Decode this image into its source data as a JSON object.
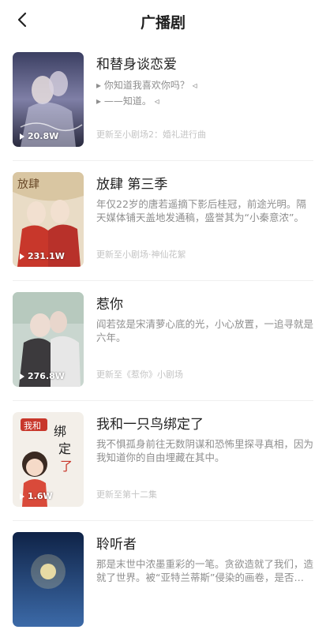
{
  "header": {
    "title": "广播剧"
  },
  "items": [
    {
      "name": "和替身谈恋爱",
      "lyrics": [
        "▸ 你知道我喜欢你吗？ ◃",
        "▸ ——知道。 ◃"
      ],
      "plays": "20.8W",
      "updated": "更新至小剧场2：婚礼进行曲",
      "cover_color": "#4a4f70"
    },
    {
      "name": "放肆 第三季",
      "desc": "年仅22岁的唐若遥摘下影后桂冠，前途光明。隔天媒体铺天盖地发通稿，盛誉其为“小秦意浓”。",
      "plays": "231.1W",
      "updated": "更新至小剧场·神仙花絮",
      "cover_color": "#c8372b"
    },
    {
      "name": "惹你",
      "desc": "阎若弦是宋清萝心底的光，小心放置，一追寻就是六年。",
      "plays": "276.8W",
      "updated": "更新至《惹你》小剧场",
      "cover_color": "#8a8f8e"
    },
    {
      "name": "我和一只鸟绑定了",
      "desc": "我不惧孤身前往无数阴谋和恐怖里探寻真相，因为我知道你的自由埋藏在其中。",
      "plays": "1.6W",
      "updated": "更新至第十二集",
      "cover_color": "#f3efe9"
    },
    {
      "name": "聆听者",
      "desc": "那是末世中浓墨重彩的一笔。贪欲造就了我们，造就了世界。被“亚特兰蒂斯”侵染的画卷，是否…",
      "plays": "",
      "updated": "",
      "cover_color": "#1e3a66"
    }
  ]
}
